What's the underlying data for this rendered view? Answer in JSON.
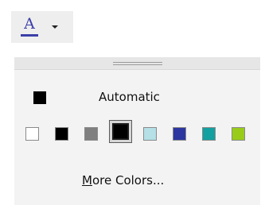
{
  "toolbar": {
    "font_color_letter": "A",
    "current_color": "#3b3fa8"
  },
  "menu": {
    "automatic_label": "Automatic",
    "automatic_color": "#000000",
    "swatches": [
      {
        "color": "#ffffff",
        "selected": false
      },
      {
        "color": "#000000",
        "selected": false
      },
      {
        "color": "#7f7f7f",
        "selected": false
      },
      {
        "color": "#000000",
        "selected": true
      },
      {
        "color": "#b4e0e6",
        "selected": false
      },
      {
        "color": "#2b36a0",
        "selected": false
      },
      {
        "color": "#12a0a0",
        "selected": false
      },
      {
        "color": "#99cc1a",
        "selected": false
      }
    ],
    "more_colors_mnemonic": "M",
    "more_colors_rest": "ore Colors..."
  }
}
